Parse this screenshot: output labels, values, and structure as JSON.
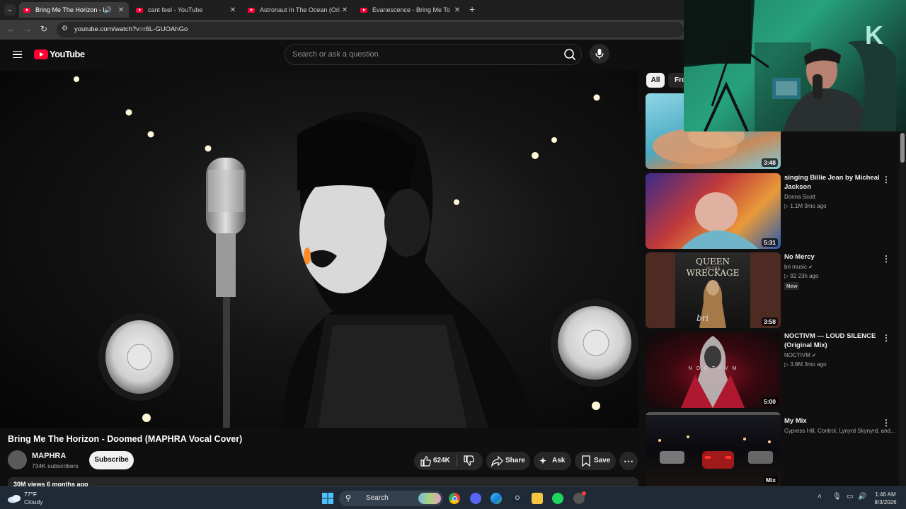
{
  "browser": {
    "tabs": [
      {
        "title": "Bring Me The Horizon - Do",
        "active": true,
        "audio": true
      },
      {
        "title": "cant feel - YouTube",
        "active": false
      },
      {
        "title": "Astronaut In The Ocean (Origin",
        "active": false
      },
      {
        "title": "Evanescence - Bring Me To Life",
        "active": false
      }
    ],
    "url": "youtube.com/watch?v=r6L-GUOAhGo"
  },
  "header": {
    "logo_text": "YouTube",
    "search_placeholder": "Search or ask a question"
  },
  "video": {
    "title": "Bring Me The Horizon - Doomed (MAPHRA Vocal Cover)",
    "channel": "MAPHRA",
    "subscribers": "734K subscribers",
    "subscribe_label": "Subscribe",
    "likes": "624K",
    "share_label": "Share",
    "ask_label": "Ask",
    "save_label": "Save",
    "views_date": "30M views  6 months ago"
  },
  "sidebar": {
    "chips": [
      "All",
      "Fro"
    ],
    "items": [
      {
        "title": "",
        "channel": "",
        "meta": "",
        "duration": "3:48"
      },
      {
        "title": "singing Billie Jean by Micheal Jackson",
        "channel": "Donna Scott",
        "meta": "▷ 1.1M   3mo ago",
        "duration": "5:31"
      },
      {
        "title": "No Mercy",
        "channel": "bri music",
        "meta": "▷ 92   23h ago",
        "badge": "New",
        "duration": "3:58",
        "thumb_text_top": "QUEEN",
        "thumb_text_small": "OF THE",
        "thumb_text_main": "WRECKAGE",
        "thumb_text_sig": "bri"
      },
      {
        "title": "NOCTIVM — LOUD SILENCE (Original Mix)",
        "channel": "NOCTIVM",
        "meta": "▷ 3.9M   3mo ago",
        "duration": "5:00",
        "thumb_text": "N  O  C  T  I  V  M"
      },
      {
        "title": "My Mix",
        "channel": "Cypress Hill, Control, Lynyrd Skynyrd, and...",
        "meta": "",
        "duration": "Mix"
      }
    ]
  },
  "taskbar": {
    "weather_temp": "77°F",
    "weather_desc": "Cloudy",
    "search_label": "Search",
    "time": "1:46 AM",
    "date": "8/3/2026"
  },
  "colors": {
    "youtube_red": "#ff0033",
    "background": "#0f0f0f",
    "webcam_green": "#27a27c"
  }
}
